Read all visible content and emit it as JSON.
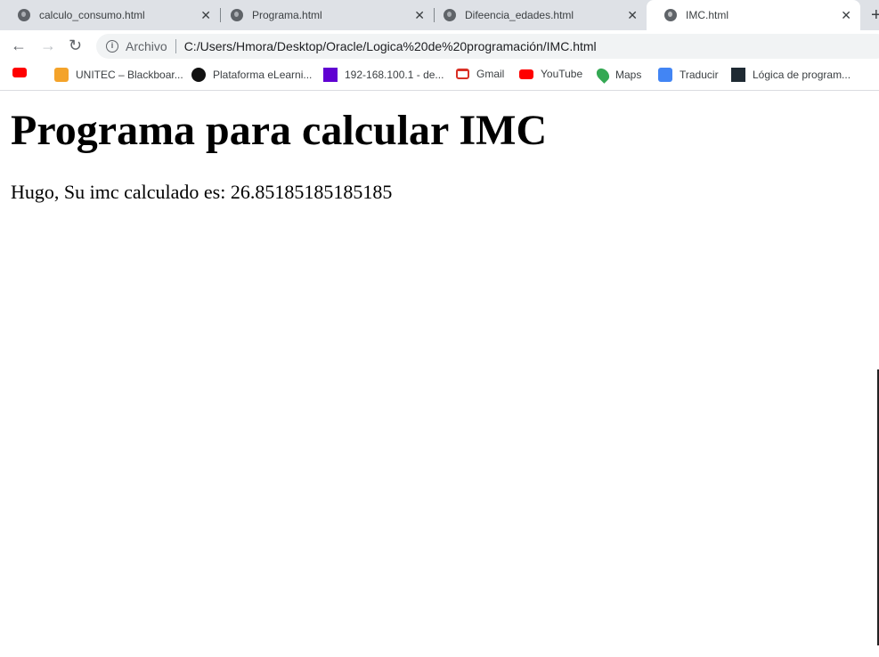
{
  "tabs": [
    {
      "title": "calculo_consumo.html",
      "icon": "globe-icon",
      "active": false
    },
    {
      "title": "Programa.html",
      "icon": "globe-icon",
      "active": false
    },
    {
      "title": "Difeencia_edades.html",
      "icon": "globe-icon",
      "active": false
    },
    {
      "title": "IMC.html",
      "icon": "globe-icon",
      "active": true
    }
  ],
  "toolbar": {
    "scheme_label": "Archivo",
    "url": "C:/Users/Hmora/Desktop/Oracle/Logica%20de%20programación/IMC.html"
  },
  "bookmarks": [
    {
      "label": "",
      "icon": "youtube-icon",
      "color": "#ff0000"
    },
    {
      "label": "UNITEC – Blackboar...",
      "icon": "pencil-icon",
      "color": "#f4a32a"
    },
    {
      "label": "Plataforma eLearni...",
      "icon": "code-logo-icon",
      "color": "#111111"
    },
    {
      "label": "192-168.100.1 - de...",
      "icon": "yahoo-icon",
      "color": "#6001d2"
    },
    {
      "label": "Gmail",
      "icon": "gmail-icon",
      "color": "#d93025"
    },
    {
      "label": "YouTube",
      "icon": "youtube-icon",
      "color": "#ff0000"
    },
    {
      "label": "Maps",
      "icon": "maps-pin-icon",
      "color": "#34a853"
    },
    {
      "label": "Traducir",
      "icon": "translate-icon",
      "color": "#4285f4"
    },
    {
      "label": "Lógica de program...",
      "icon": "a-logo-icon",
      "color": "#1f2a33"
    }
  ],
  "page": {
    "heading": "Programa para calcular IMC",
    "result": "Hugo, Su imc calculado es: 26.85185185185185"
  }
}
